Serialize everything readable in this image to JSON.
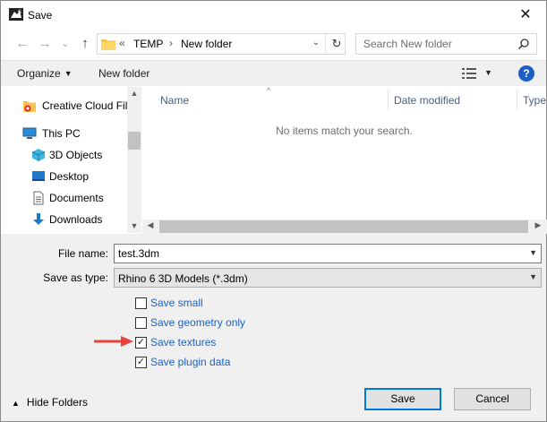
{
  "window": {
    "title": "Save",
    "close_glyph": "✕"
  },
  "nav": {
    "back_glyph": "←",
    "forward_glyph": "→",
    "recent_glyph": "⌄",
    "up_glyph": "↑"
  },
  "address": {
    "overflow": "«",
    "crumbs": [
      "TEMP",
      "New folder"
    ],
    "separator": "›",
    "dropdown_glyph": "⌄",
    "refresh_glyph": "↻"
  },
  "search": {
    "placeholder": "Search New folder"
  },
  "toolbar": {
    "organize_label": "Organize",
    "caret": "▼",
    "new_folder_label": "New folder",
    "help_label": "?"
  },
  "sidebar": {
    "items": [
      {
        "label": "Creative Cloud Fil",
        "icon": "creative-cloud-icon"
      },
      {
        "label": "This PC",
        "icon": "computer-icon"
      },
      {
        "label": "3D Objects",
        "icon": "3d-objects-icon"
      },
      {
        "label": "Desktop",
        "icon": "desktop-icon"
      },
      {
        "label": "Documents",
        "icon": "documents-icon"
      },
      {
        "label": "Downloads",
        "icon": "downloads-icon"
      }
    ]
  },
  "filelist": {
    "columns": [
      "Name",
      "Date modified",
      "Type"
    ],
    "sort_glyph": "^",
    "empty_message": "No items match your search."
  },
  "form": {
    "filename_label": "File name:",
    "filename_value": "test.3dm",
    "savetype_label": "Save as type:",
    "savetype_value": "Rhino 6 3D Models (*.3dm)",
    "options": [
      {
        "label": "Save small",
        "checked": false
      },
      {
        "label": "Save geometry only",
        "checked": false
      },
      {
        "label": "Save textures",
        "checked": true
      },
      {
        "label": "Save plugin data",
        "checked": true
      }
    ]
  },
  "footer": {
    "hide_folders_label": "Hide Folders",
    "hide_caret": "▲",
    "save_label": "Save",
    "cancel_label": "Cancel"
  },
  "colors": {
    "accent": "#0078d7",
    "link": "#1a62c9",
    "annotation_arrow": "#e8443a"
  }
}
